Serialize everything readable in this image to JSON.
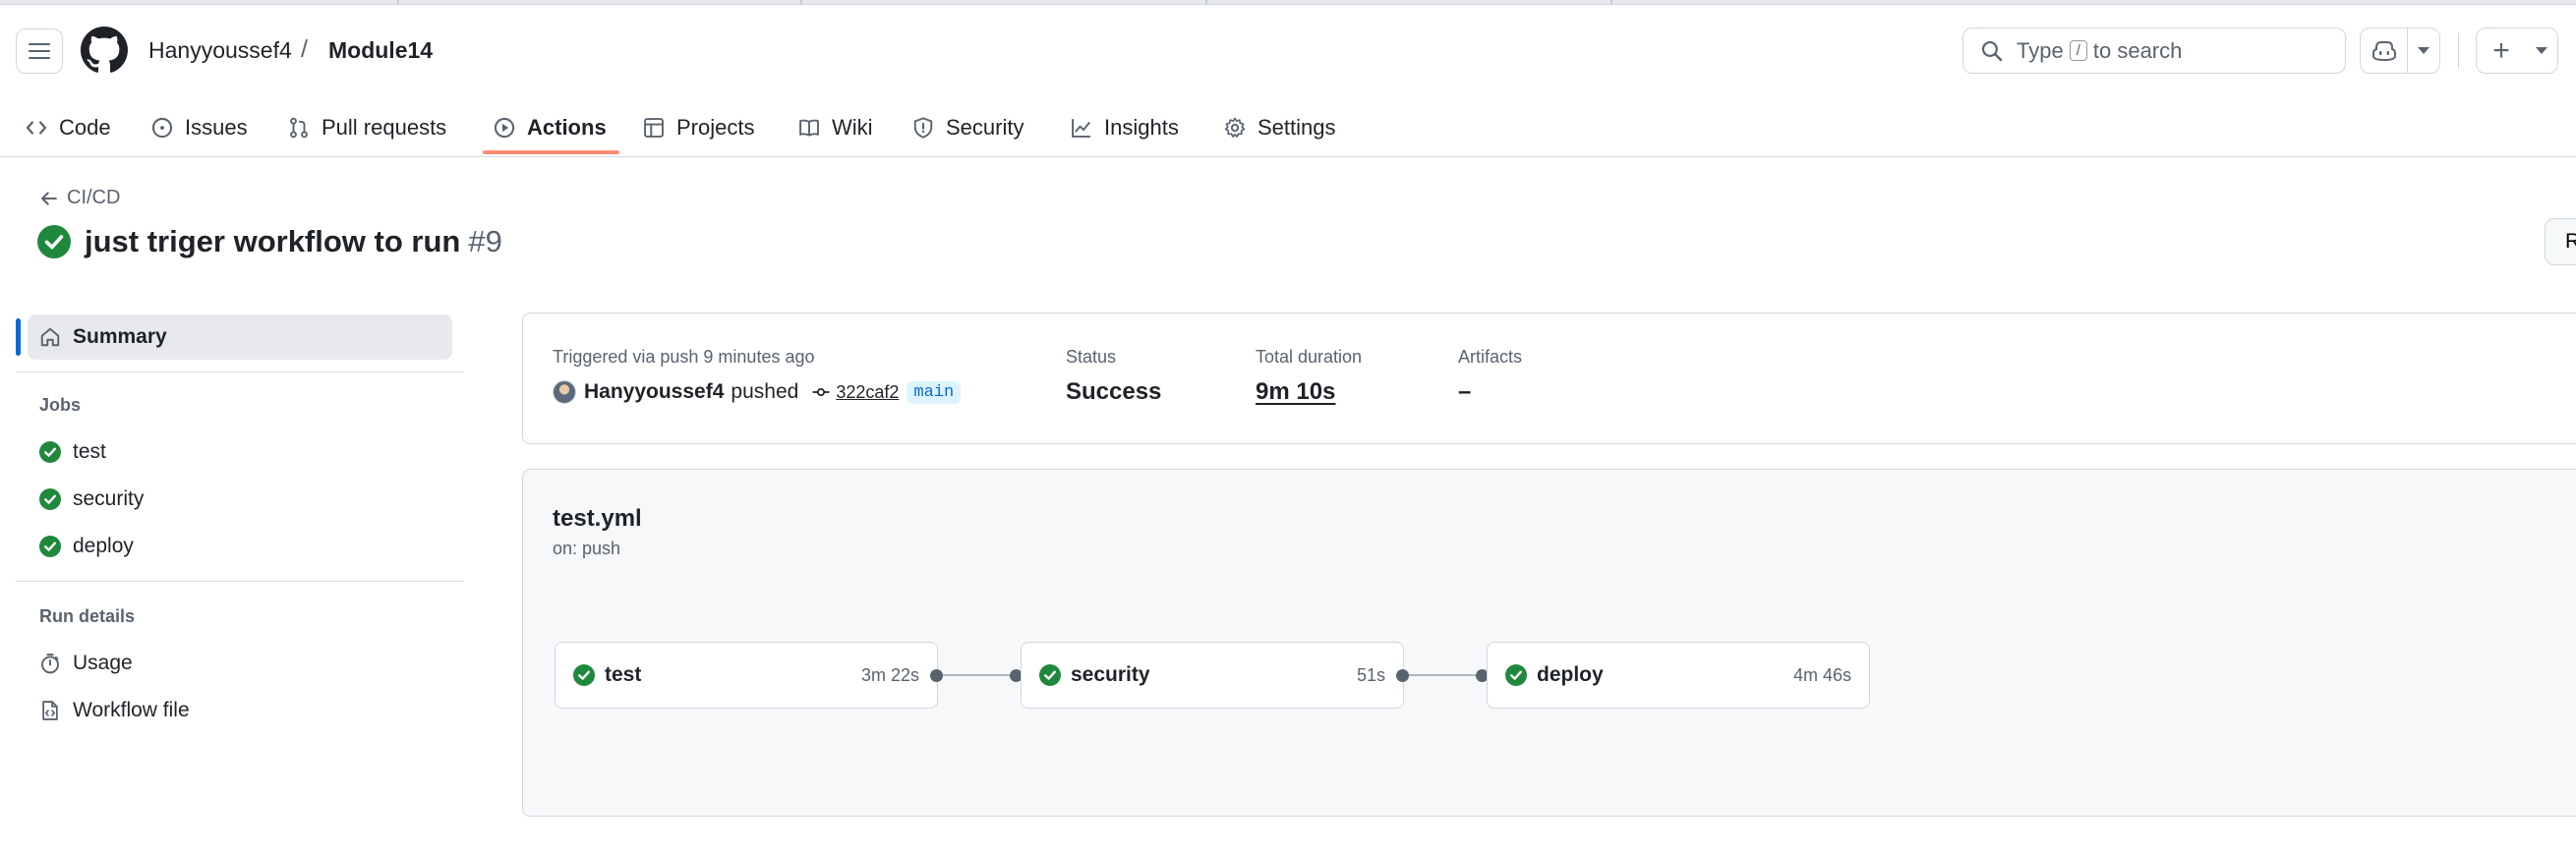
{
  "header": {
    "owner": "Hanyyoussef4",
    "separator": "/",
    "repo": "Module14",
    "search": {
      "prefix": "Type",
      "key": "/",
      "suffix": "to search"
    },
    "plus_label": "+"
  },
  "nav": {
    "code": "Code",
    "issues": "Issues",
    "pull_requests": "Pull requests",
    "actions": "Actions",
    "projects": "Projects",
    "wiki": "Wiki",
    "security": "Security",
    "insights": "Insights",
    "settings": "Settings",
    "active": "Actions"
  },
  "run": {
    "back_label": "CI/CD",
    "title": "just triger workflow to run",
    "number": "#9",
    "rerun_label": "R"
  },
  "sidebar": {
    "summary": "Summary",
    "jobs_heading": "Jobs",
    "jobs": [
      "test",
      "security",
      "deploy"
    ],
    "run_details_heading": "Run details",
    "usage": "Usage",
    "workflow_file": "Workflow file"
  },
  "summary": {
    "triggered_label": "Triggered via push 9 minutes ago",
    "user": "Hanyyoussef4",
    "verb": "pushed",
    "commit": "322caf2",
    "branch": "main",
    "status_label": "Status",
    "status_value": "Success",
    "duration_label": "Total duration",
    "duration_value": "9m 10s",
    "artifacts_label": "Artifacts",
    "artifacts_value": "–"
  },
  "workflow": {
    "file": "test.yml",
    "trigger": "on: push",
    "jobs": [
      {
        "name": "test",
        "duration": "3m 22s"
      },
      {
        "name": "security",
        "duration": "51s"
      },
      {
        "name": "deploy",
        "duration": "4m 46s"
      }
    ]
  },
  "colors": {
    "success": "#1f883d",
    "accent_underline": "#fd8c73",
    "selected_indicator": "#0969da",
    "branch_bg": "#ddf4ff",
    "branch_fg": "#0969da"
  },
  "icons": {
    "menu": "hamburger-icon",
    "logo": "github-logo",
    "search": "search-icon",
    "copilot": "copilot-icon",
    "success": "check-circle-fill-icon",
    "home": "home-icon",
    "stopwatch": "stopwatch-icon",
    "file": "file-code-icon"
  }
}
